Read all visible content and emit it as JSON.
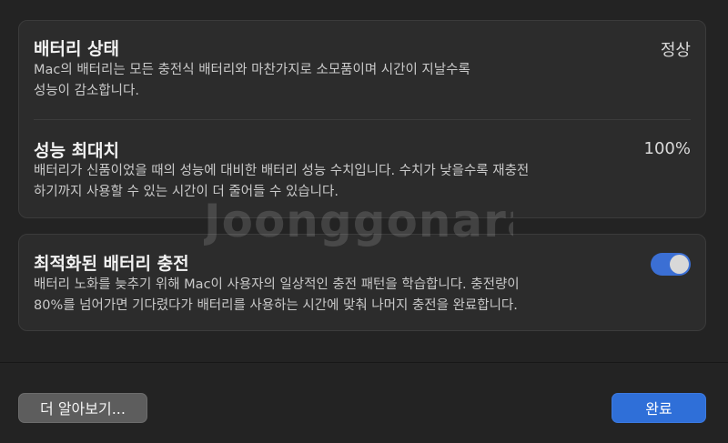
{
  "battery_health": {
    "title": "배터리 상태",
    "value": "정상",
    "description": "Mac의 배터리는 모든 충전식 배터리와 마찬가지로 소모품이며 시간이 지날수록\n성능이 감소합니다."
  },
  "maximum_capacity": {
    "title": "성능 최대치",
    "value": "100%",
    "description": "배터리가 신품이었을 때의 성능에 대비한 배터리 성능 수치입니다. 수치가 낮을수록 재충전\n하기까지 사용할 수 있는 시간이 더 줄어들 수 있습니다."
  },
  "optimized_charging": {
    "title": "최적화된 배터리 충전",
    "enabled": true,
    "description": "배터리 노화를 늦추기 위해 Mac이 사용자의 일상적인 충전 패턴을 학습합니다. 충전량이\n80%를 넘어가면 기다렸다가 배터리를 사용하는 시간에 맞춰 나머지 충전을 완료합니다."
  },
  "buttons": {
    "learn_more": "더 알아보기...",
    "done": "완료"
  },
  "watermark": {
    "text": "Joonggonara"
  },
  "colors": {
    "accent": "#2f6fd8",
    "background": "#232323",
    "card": "#2c2c2c"
  }
}
